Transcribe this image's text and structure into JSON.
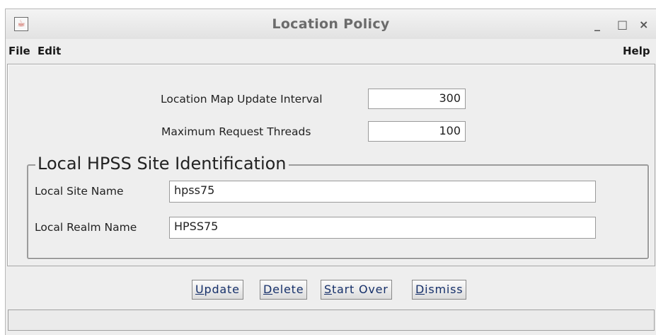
{
  "window": {
    "title": "Location Policy",
    "controls": {
      "minimize": "_",
      "maximize": "□",
      "close": "×"
    }
  },
  "menubar": {
    "file": "File",
    "edit": "Edit",
    "help": "Help"
  },
  "form": {
    "update_interval_label": "Location Map Update Interval",
    "update_interval_value": "300",
    "max_threads_label": "Maximum Request Threads",
    "max_threads_value": "100"
  },
  "site_group": {
    "title": "Local HPSS Site Identification",
    "site_name_label": "Local Site Name",
    "site_name_value": "hpss75",
    "realm_name_label": "Local Realm Name",
    "realm_name_value": "HPSS75"
  },
  "buttons": {
    "update": "Update",
    "delete": "Delete",
    "start_over": "Start Over",
    "dismiss": "Dismiss"
  },
  "status": {
    "message": ""
  }
}
